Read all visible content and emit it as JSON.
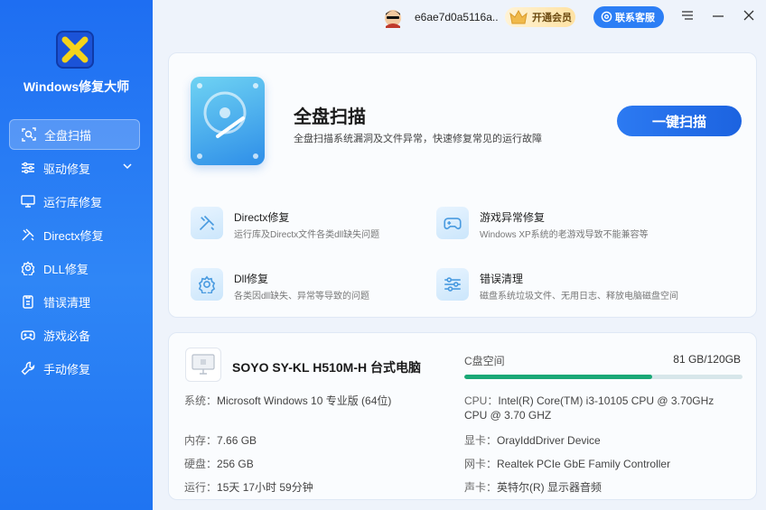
{
  "app": {
    "title": "Windows修复大师"
  },
  "sidebar": {
    "items": [
      {
        "label": "全盘扫描",
        "icon": "scan-icon",
        "active": true
      },
      {
        "label": "驱动修复",
        "icon": "sliders-icon",
        "has_chevron": true
      },
      {
        "label": "运行库修复",
        "icon": "monitor-icon"
      },
      {
        "label": "Directx修复",
        "icon": "tools-icon"
      },
      {
        "label": "DLL修复",
        "icon": "gear-icon"
      },
      {
        "label": "错误清理",
        "icon": "clipboard-icon"
      },
      {
        "label": "游戏必备",
        "icon": "gamepad-icon"
      },
      {
        "label": "手动修复",
        "icon": "wrench-icon"
      }
    ]
  },
  "topbar": {
    "username": "e6ae7d0a5116a..",
    "vip_label": "开通会员",
    "support_label": "联系客服"
  },
  "scan": {
    "title": "全盘扫描",
    "desc": "全盘扫描系统漏洞及文件异常，快速修复常见的运行故障",
    "button": "一键扫描"
  },
  "features": [
    {
      "title": "Directx修复",
      "desc": "运行库及Directx文件各类dll缺失问题",
      "icon": "tools-icon"
    },
    {
      "title": "游戏异常修复",
      "desc": "Windows XP系统的老游戏导致不能兼容等",
      "icon": "gamepad-icon"
    },
    {
      "title": "Dll修复",
      "desc": "各类因dll缺失、异常等导致的问题",
      "icon": "gear-icon"
    },
    {
      "title": "错误清理",
      "desc": "磁盘系统垃圾文件、无用日志、释放电脑磁盘空间",
      "icon": "sliders-icon"
    }
  ],
  "pc": {
    "name": "SOYO SY-KL H510M-H 台式电脑",
    "os_label": "系统：",
    "os": "Microsoft Windows 10 专业版 (64位)",
    "mem_label": "内存：",
    "mem": "7.66 GB",
    "disk_label": "硬盘：",
    "disk": "256 GB",
    "uptime_label": "运行：",
    "uptime": "15天 17小时 59分钟",
    "cpu_label": "CPU：",
    "cpu_line1": "Intel(R) Core(TM) i3-10105 CPU @ 3.70GHz",
    "cpu_line2": "CPU @ 3.70 GHZ",
    "gpu_label": "显卡：",
    "gpu": "OrayIddDriver Device",
    "net_label": "网卡：",
    "net": "Realtek PCIe GbE Family Controller",
    "sound_label": "声卡：",
    "sound": "英特尔(R) 显示器音频"
  },
  "cdrive": {
    "label": "C盘空间",
    "value": "81 GB/120GB",
    "used_fraction": 0.675
  },
  "colors": {
    "accent": "#2c7af2",
    "sidebar": "#1e6ef2",
    "disk_fill": "#1aa876"
  }
}
